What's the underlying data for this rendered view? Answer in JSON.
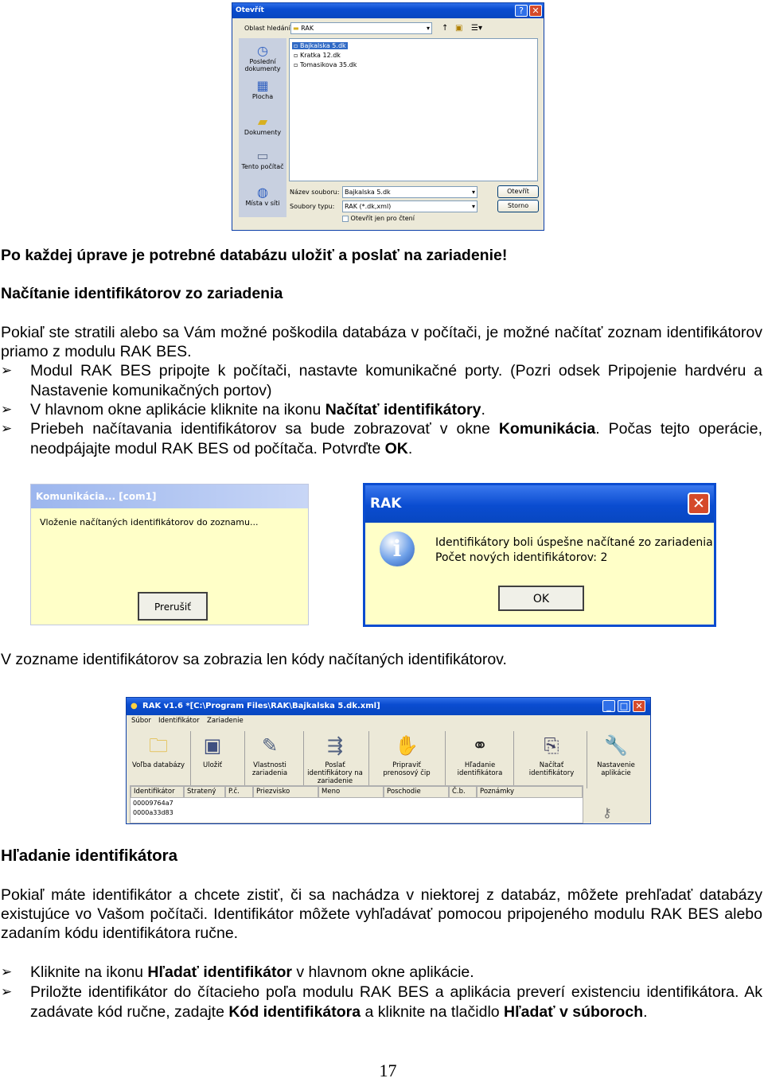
{
  "open_dialog": {
    "title": "Otevřít",
    "lookin_label": "Oblast hledání:",
    "lookin_value": "RAK",
    "places": [
      "Poslední dokumenty",
      "Plocha",
      "Dokumenty",
      "Tento počítač",
      "Místa v síti"
    ],
    "files": [
      "Bajkalska 5.dk",
      "Kratka 12.dk",
      "Tomasikova 35.dk"
    ],
    "filename_label": "Název souboru:",
    "filename_value": "Bajkalska 5.dk",
    "filetype_label": "Soubory typu:",
    "filetype_value": "RAK (*.dk,xml)",
    "readonly_label": "Otevřít jen pro čtení",
    "open_button": "Otevřít",
    "cancel_button": "Storno"
  },
  "text": {
    "p1": "Po každej úprave je potrebné databázu uložiť a poslať na zariadenie!",
    "h1": "Načítanie identifikátorov zo zariadenia",
    "p2": "Pokiaľ ste stratili alebo sa Vám možné poškodila databáza v počítači, je možné načítať zoznam identifikátorov priamo z modulu RAK BES.",
    "b1": "Modul RAK BES pripojte k počítači, nastavte komunikačné porty. (Pozri odsek Pripojenie hardvéru a Nastavenie komunikačných portov)",
    "b2_a": "V hlavnom okne aplikácie kliknite na ikonu ",
    "b2_b": "Načítať identifikátory",
    "b2_c": ".",
    "b3_a": "Priebeh načítavania identifikátorov sa bude zobrazovať v okne ",
    "b3_b": "Komunikácia",
    "b3_c": ". Počas tejto operácie, neodpájajte modul RAK BES od počítača. Potvrďte ",
    "b3_d": "OK",
    "b3_e": ".",
    "p3": "V zozname identifikátorov sa zobrazia len kódy načítaných identifikátorov.",
    "h2": "Hľadanie identifikátora",
    "p4": "Pokiaľ máte identifikátor a chcete zistiť, či sa nachádza v niektorej z databáz, môžete prehľadať databázy existujúce vo Vašom počítači. Identifikátor môžete vyhľadávať pomocou pripojeného modulu RAK BES alebo zadaním kódu identifikátora ručne.",
    "b4_a": "Kliknite na ikonu ",
    "b4_b": "Hľadať identifikátor",
    "b4_c": " v hlavnom okne aplikácie.",
    "b5_a": "Priložte identifikátor do čítacieho poľa modulu RAK BES a aplikácia preverí existenciu identifikátora. Ak zadávate kód ručne, zadajte ",
    "b5_b": "Kód identifikátora",
    "b5_c": " a kliknite na tlačidlo ",
    "b5_d": "Hľadať v súboroch",
    "b5_e": ".",
    "bullet_mark": "➢",
    "page_number": "17"
  },
  "comm_dialog": {
    "title": "Komunikácia... [com1]",
    "message": "Vloženie načítaných identifikátorov do zoznamu...",
    "button": "Prerušiť"
  },
  "rak_dialog": {
    "title": "RAK",
    "line1": "Identifikátory boli úspešne načítané zo zariadenia",
    "line2": "Počet nových identifikátorov: 2",
    "button": "OK"
  },
  "app_window": {
    "title": "RAK v1.6 *[C:\\Program Files\\RAK\\Bajkalska 5.dk.xml]",
    "menu": [
      "Súbor",
      "Identifikátor",
      "Zariadenie"
    ],
    "tools": [
      {
        "label": "Voľba databázy",
        "icon": "folder-icon"
      },
      {
        "label": "Uložiť",
        "icon": "floppy-icon"
      },
      {
        "label": "Vlastnosti zariadenia",
        "icon": "properties-icon"
      },
      {
        "label": "Poslať identifikátory na zariadenie",
        "icon": "send-icon"
      },
      {
        "label": "Pripraviť prenosový čip",
        "icon": "chip-icon"
      },
      {
        "label": "Hľadanie identifikátora",
        "icon": "binoculars-icon"
      },
      {
        "label": "Načítať identifikátory",
        "icon": "read-icon"
      },
      {
        "label": "Nastavenie aplikácie",
        "icon": "wrench-icon"
      }
    ],
    "columns": [
      "Identifikátor",
      "Stratený",
      "P.č.",
      "Priezvisko",
      "Meno",
      "Poschodie",
      "Č.b.",
      "Poznámky"
    ],
    "rows": [
      "00009764a7",
      "0000a33d83"
    ]
  },
  "colors": {
    "xp_blue": "#0a4cd0",
    "comm_bg": "#ffffc8",
    "rak_bg": "#ffffc8",
    "close_red": "#d54a2a"
  }
}
